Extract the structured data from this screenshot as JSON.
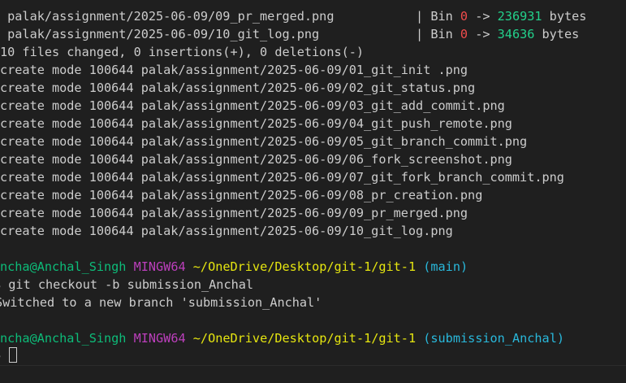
{
  "stat_lines": [
    {
      "path": " palak/assignment/2025-06-09/09_pr_merged.png",
      "sep": "           | Bin ",
      "old": "0",
      "arrow": " -> ",
      "new": "236931",
      "unit": " bytes"
    },
    {
      "path": " palak/assignment/2025-06-09/10_git_log.png",
      "sep": "             | Bin ",
      "old": "0",
      "arrow": " -> ",
      "new": "34636",
      "unit": " bytes"
    }
  ],
  "summary": "10 files changed, 0 insertions(+), 0 deletions(-)",
  "create_lines": [
    "create mode 100644 palak/assignment/2025-06-09/01_git_init .png",
    "create mode 100644 palak/assignment/2025-06-09/02_git_status.png",
    "create mode 100644 palak/assignment/2025-06-09/03_git_add_commit.png",
    "create mode 100644 palak/assignment/2025-06-09/04_git_push_remote.png",
    "create mode 100644 palak/assignment/2025-06-09/05_git_branch_commit.png",
    "create mode 100644 palak/assignment/2025-06-09/06_fork_screenshot.png",
    "create mode 100644 palak/assignment/2025-06-09/07_git_fork_branch_commit.png",
    "create mode 100644 palak/assignment/2025-06-09/08_pr_creation.png",
    "create mode 100644 palak/assignment/2025-06-09/09_pr_merged.png",
    "create mode 100644 palak/assignment/2025-06-09/10_git_log.png"
  ],
  "prompt1": {
    "user": "ncha@Anchal_Singh",
    "shell": "MINGW64",
    "path": "~/OneDrive/Desktop/git-1/git-1",
    "branch": "(main)"
  },
  "command": "$ git checkout -b submission_Anchal",
  "output": "Switched to a new branch 'submission_Anchal'",
  "prompt2": {
    "user": "ncha@Anchal_Singh",
    "shell": "MINGW64",
    "path": "~/OneDrive/Desktop/git-1/git-1",
    "branch": "(submission_Anchal)"
  },
  "input_prompt": "$ ",
  "colors": {
    "background": "#1f1f1f",
    "text": "#cccccc",
    "deleted": "#f14c4c",
    "added": "#23d18b",
    "user": "#0dbc79",
    "shell": "#bc3fbc",
    "path": "#e5e510",
    "branch": "#29b8db"
  }
}
